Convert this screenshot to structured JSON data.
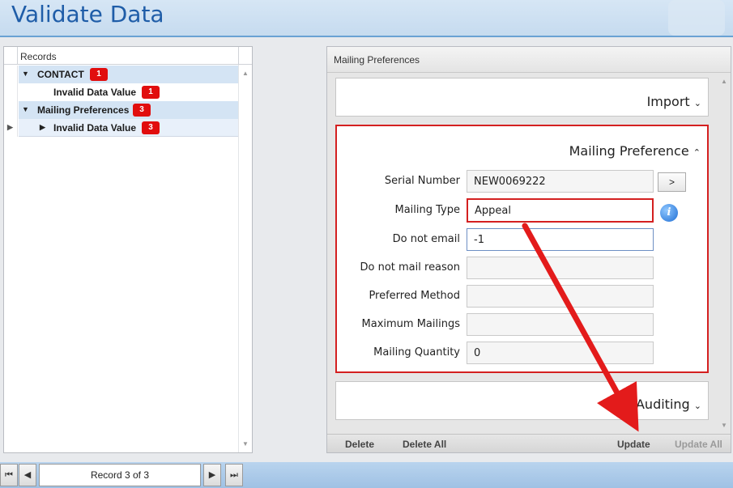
{
  "window": {
    "title": "Validate Data"
  },
  "tree": {
    "header": "Records",
    "rows": [
      {
        "label": "CONTACT",
        "badge": "1",
        "level": 0,
        "expanded": true
      },
      {
        "label": "Invalid Data Value",
        "badge": "1",
        "level": 1
      },
      {
        "label": "Mailing Preferences",
        "badge": "3",
        "level": 0,
        "expanded": true
      },
      {
        "label": "Invalid Data Value",
        "badge": "3",
        "level": 1,
        "selected": true
      }
    ]
  },
  "panel": {
    "header": "Mailing Preferences",
    "sections": {
      "import": "Import",
      "mailing": "Mailing Preference",
      "auditing": "Auditing"
    },
    "fields": [
      {
        "label": "Serial Number",
        "value": "NEW0069222"
      },
      {
        "label": "Mailing Type",
        "value": "Appeal"
      },
      {
        "label": "Do not email",
        "value": "-1"
      },
      {
        "label": "Do not mail reason",
        "value": ""
      },
      {
        "label": "Preferred Method",
        "value": ""
      },
      {
        "label": "Maximum Mailings",
        "value": ""
      },
      {
        "label": "Mailing Quantity",
        "value": "0"
      }
    ],
    "go_button": ">",
    "info_icon": "i",
    "footer": {
      "delete": "Delete",
      "delete_all": "Delete All",
      "update": "Update",
      "update_all": "Update All"
    }
  },
  "navigator": {
    "position": "Record 3 of 3",
    "first": "⏮",
    "prev": "◀",
    "next": "▶",
    "last": "⏭"
  },
  "colors": {
    "accent": "#1f5da8",
    "error": "#d42020",
    "badge": "#e10e0e"
  }
}
